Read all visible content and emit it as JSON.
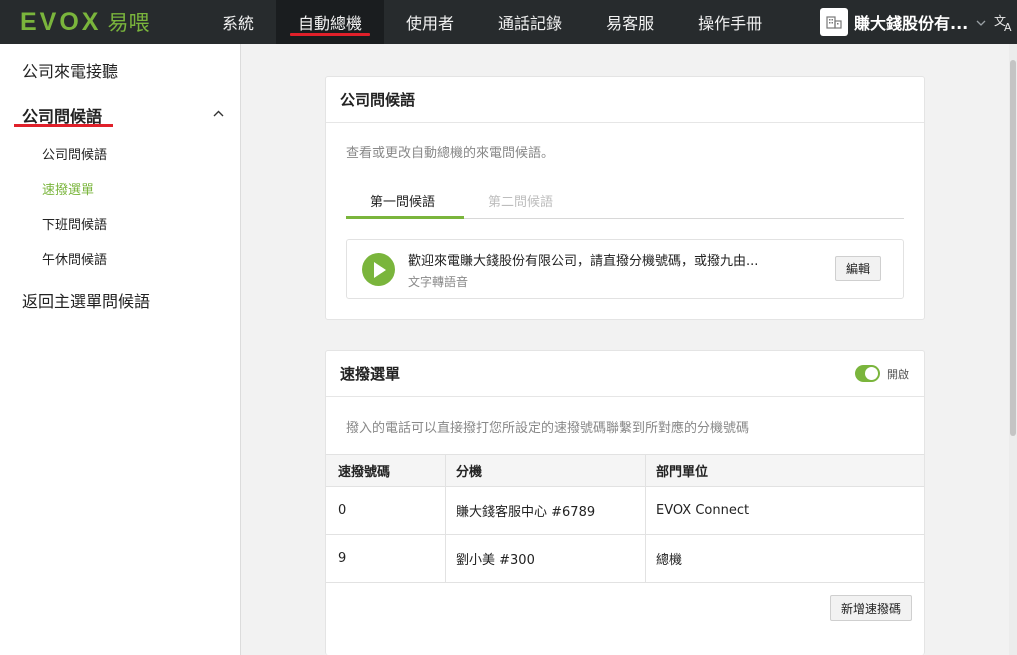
{
  "app": {
    "logo_text": "EVOX",
    "logo_cn": "易喂"
  },
  "nav": {
    "items": [
      {
        "label": "系統"
      },
      {
        "label": "自動總機"
      },
      {
        "label": "使用者"
      },
      {
        "label": "通話記錄"
      },
      {
        "label": "易客服"
      },
      {
        "label": "操作手冊"
      }
    ],
    "active_index": 1,
    "company_name": "賺大錢股份有...",
    "company_icon": "building-icon",
    "lang_icon": "translate-icon"
  },
  "sidebar": {
    "items": [
      {
        "label": "公司來電接聽"
      },
      {
        "label": "公司問候語"
      },
      {
        "label": "返回主選單問候語"
      }
    ],
    "sub_items": [
      {
        "label": "公司問候語"
      },
      {
        "label": "速撥選單"
      },
      {
        "label": "下班問候語"
      },
      {
        "label": "午休問候語"
      }
    ],
    "active_sub_index": 1
  },
  "greeting_card": {
    "title": "公司問候語",
    "description": "查看或更改自動總機的來電問候語。",
    "tabs": [
      {
        "label": "第一問候語"
      },
      {
        "label": "第二問候語"
      }
    ],
    "active_tab": 0,
    "greeting_text": "歡迎來電賺大錢股份有限公司，請直撥分機號碼，或撥九由...",
    "greeting_type": "文字轉語音",
    "edit_label": "編輯"
  },
  "speed_dial_card": {
    "title": "速撥選單",
    "toggle_label": "開啟",
    "toggle_on": true,
    "description": "撥入的電話可以直接撥打您所設定的速撥號碼聯繫到所對應的分機號碼",
    "columns": [
      "速撥號碼",
      "分機",
      "部門單位"
    ],
    "rows": [
      [
        "0",
        "賺大錢客服中心 #6789",
        "EVOX Connect"
      ],
      [
        "9",
        "劉小美 #300",
        "總機"
      ]
    ],
    "add_label": "新增速撥碼"
  },
  "colors": {
    "accent": "#7ab53c",
    "active_underline": "#e0202a",
    "topbar": "#272b2d"
  }
}
